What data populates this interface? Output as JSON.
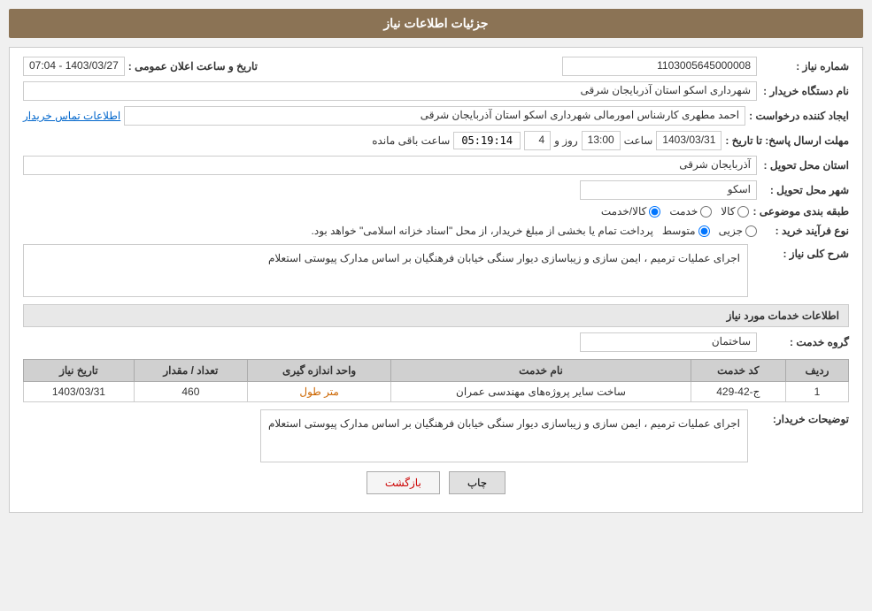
{
  "header": {
    "title": "جزئیات اطلاعات نیاز"
  },
  "fields": {
    "need_number_label": "شماره نیاز :",
    "need_number_value": "1103005645000008",
    "buyer_label": "نام دستگاه خریدار :",
    "buyer_value": "شهرداری اسکو استان آذربایجان شرقی",
    "creator_label": "ایجاد کننده درخواست :",
    "creator_value": "احمد مطهری کارشناس امورمالی شهرداری اسکو استان آذربایجان شرقی",
    "contact_link": "اطلاعات تماس خریدار",
    "deadline_label": "مهلت ارسال پاسخ: تا تاریخ :",
    "deadline_date": "1403/03/31",
    "deadline_time_label": "ساعت",
    "deadline_time": "13:00",
    "deadline_days_label": "روز و",
    "deadline_days": "4",
    "remaining_label": "ساعت باقی مانده",
    "remaining_time": "05:19:14",
    "province_label": "استان محل تحویل :",
    "province_value": "آذربایجان شرقی",
    "city_label": "شهر محل تحویل :",
    "city_value": "اسکو",
    "category_label": "طبقه بندی موضوعی :",
    "category_options": [
      {
        "label": "کالا",
        "checked": false
      },
      {
        "label": "خدمت",
        "checked": false
      },
      {
        "label": "کالا/خدمت",
        "checked": true
      }
    ],
    "purchase_type_label": "نوع فرآیند خرید :",
    "purchase_type_options": [
      {
        "label": "جزیی",
        "checked": false
      },
      {
        "label": "متوسط",
        "checked": true
      }
    ],
    "purchase_type_note": "پرداخت تمام یا بخشی از مبلغ خریدار، از محل \"اسناد خزانه اسلامی\" خواهد بود.",
    "announce_label": "تاریخ و ساعت اعلان عمومی :",
    "announce_value": "1403/03/27 - 07:04"
  },
  "description_section": {
    "title": "شرح کلی نیاز :",
    "content": "اجرای عملیات ترمیم ، ایمن سازی و زیباسازی دیوار سنگی خیابان فرهنگیان بر اساس مدارک پیوستی استعلام"
  },
  "service_section": {
    "title": "اطلاعات خدمات مورد نیاز",
    "group_label": "گروه خدمت :",
    "group_value": "ساختمان"
  },
  "table": {
    "columns": [
      "ردیف",
      "کد خدمت",
      "نام خدمت",
      "واحد اندازه گیری",
      "تعداد / مقدار",
      "تاریخ نیاز"
    ],
    "rows": [
      {
        "row": "1",
        "code": "ج-42-429",
        "name": "ساخت سایر پروژه‌های مهندسی عمران",
        "unit": "متر طول",
        "quantity": "460",
        "date": "1403/03/31"
      }
    ]
  },
  "buyer_notes_section": {
    "label": "توضیحات خریدار:",
    "content": "اجرای عملیات ترمیم ، ایمن سازی و زیباسازی دیوار سنگی خیابان فرهنگیان بر اساس مدارک پیوستی استعلام"
  },
  "buttons": {
    "print": "چاپ",
    "back": "بازگشت"
  }
}
